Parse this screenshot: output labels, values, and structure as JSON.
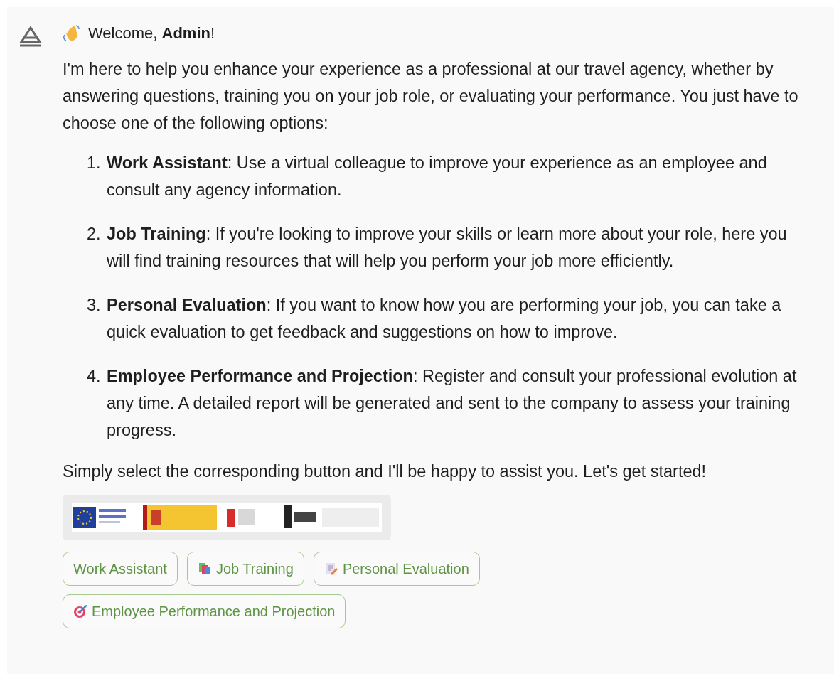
{
  "message": {
    "greeting": "Welcome, **Admin**!",
    "intro": "I'm here to help you enhance your experience as a professional at our travel agency, whether by answering questions, training you on your job role, or evaluating your performance. You just have to choose one of the following options:",
    "options": [
      {
        "number": "1.",
        "text": "**Work Assistant**: Use a virtual colleague to improve your experience as an employee and consult any agency information."
      },
      {
        "number": "2.",
        "text": "**Job Training**: If you're looking to improve your skills or learn more about your role, here you will find training resources that will help you perform your job more efficiently."
      },
      {
        "number": "3.",
        "text": "**Personal Evaluation**: If you want to know how you are performing your job, you can take a quick evaluation to get feedback and suggestions on how to improve."
      },
      {
        "number": "4.",
        "text": "**Employee Performance and Projection**: Register and consult your professional evolution at any time. A detailed report will be generated and sent to the company to assess your training progress."
      }
    ],
    "closing": "Simply select the corresponding button and I'll be happy to assist you. Let's get started!"
  },
  "buttons": [
    {
      "label": "Work Assistant"
    },
    {
      "label": "Job Training",
      "kind": "books"
    },
    {
      "label": "Personal Evaluation",
      "kind": "memo"
    },
    {
      "label": "Employee Performance and Projection",
      "kind": "target"
    }
  ]
}
